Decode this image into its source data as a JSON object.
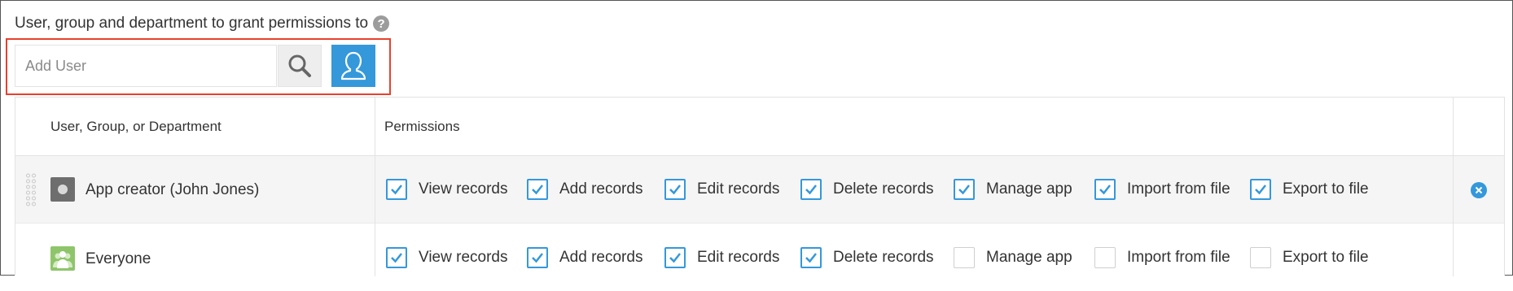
{
  "section": {
    "title": "User, group and department to grant permissions to",
    "help_icon": "question-icon"
  },
  "add_user": {
    "placeholder": "Add User",
    "search_icon": "search-icon",
    "picker_icon": "user-silhouette-icon"
  },
  "colors": {
    "accent": "#3498db",
    "highlight": "#e8412e",
    "row_shaded": "#f5f5f5",
    "border": "#e3e3e3"
  },
  "table": {
    "headers": {
      "entity": "User, Group, or Department",
      "permissions": "Permissions"
    },
    "rows": [
      {
        "name": "App creator (John Jones)",
        "icon": "creator-icon",
        "permissions": [
          {
            "label": "View records",
            "checked": true
          },
          {
            "label": "Add records",
            "checked": true
          },
          {
            "label": "Edit records",
            "checked": true
          },
          {
            "label": "Delete records",
            "checked": true
          },
          {
            "label": "Manage app",
            "checked": true
          },
          {
            "label": "Import from file",
            "checked": true
          },
          {
            "label": "Export to file",
            "checked": true
          }
        ],
        "removable": true
      },
      {
        "name": "Everyone",
        "icon": "group-icon",
        "permissions": [
          {
            "label": "View records",
            "checked": true
          },
          {
            "label": "Add records",
            "checked": true
          },
          {
            "label": "Edit records",
            "checked": true
          },
          {
            "label": "Delete records",
            "checked": true
          },
          {
            "label": "Manage app",
            "checked": false
          },
          {
            "label": "Import from file",
            "checked": false
          },
          {
            "label": "Export to file",
            "checked": false
          }
        ],
        "removable": false
      }
    ]
  }
}
